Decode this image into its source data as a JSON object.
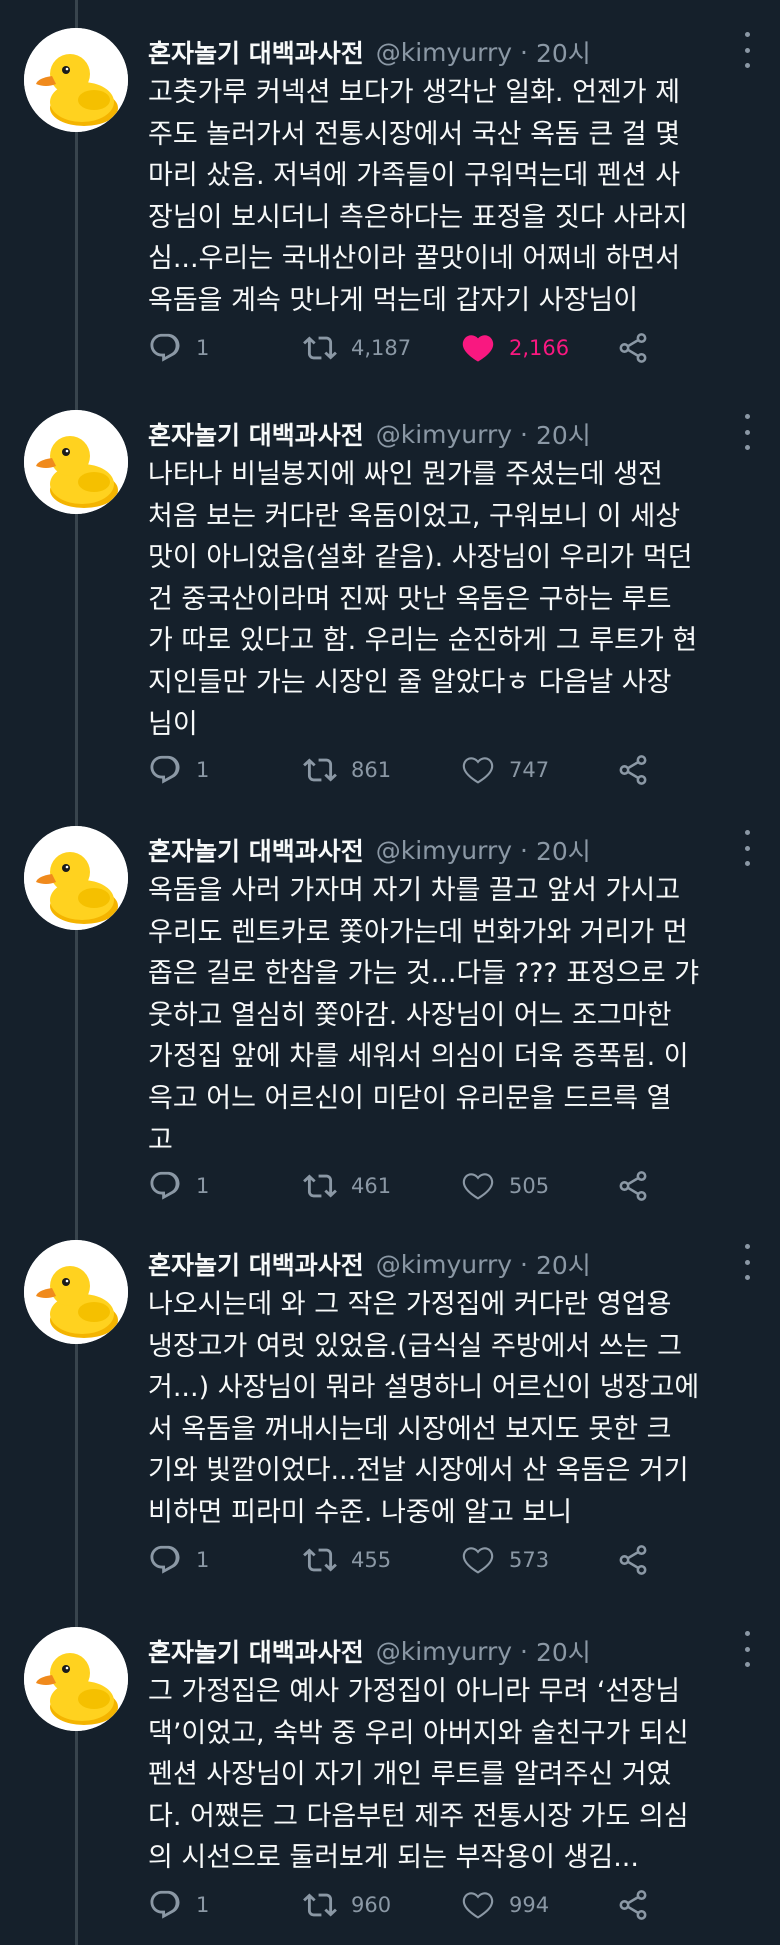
{
  "tweets": [
    {
      "name": "혼자놀기 대백과사전",
      "handle": "@kimyurry",
      "sep": "·",
      "time": "20시",
      "lines": [
        "고춧가루 커넥션 보다가 생각난 일화. 언젠가 제",
        "주도 놀러가서 전통시장에서 국산 옥돔 큰 걸 몇",
        "마리 샀음. 저녁에 가족들이 구워먹는데 펜션 사",
        "장님이 보시더니 측은하다는 표정을 짓다 사라지",
        "심...우리는 국내산이라 꿀맛이네 어쩌네 하면서",
        "옥돔을 계속 맛나게 먹는데 갑자기 사장님이"
      ],
      "replies": "1",
      "retweets": "4,187",
      "likes": "2,166",
      "liked": true
    },
    {
      "name": "혼자놀기 대백과사전",
      "handle": "@kimyurry",
      "sep": "·",
      "time": "20시",
      "lines": [
        "나타나 비닐봉지에 싸인 뭔가를 주셨는데 생전",
        "처음 보는 커다란 옥돔이었고, 구워보니 이 세상",
        "맛이 아니었음(설화 같음). 사장님이 우리가 먹던",
        "건 중국산이라며 진짜 맛난 옥돔은 구하는 루트",
        "가 따로 있다고 함. 우리는 순진하게 그 루트가 현",
        "지인들만 가는 시장인 줄 알았다ㅎ 다음날 사장",
        "님이"
      ],
      "replies": "1",
      "retweets": "861",
      "likes": "747",
      "liked": false
    },
    {
      "name": "혼자놀기 대백과사전",
      "handle": "@kimyurry",
      "sep": "·",
      "time": "20시",
      "lines": [
        "옥돔을 사러 가자며 자기 차를 끌고 앞서 가시고",
        "우리도 렌트카로 쫓아가는데 번화가와 거리가 먼",
        "좁은 길로 한참을 가는 것...다들 ??? 표정으로 갸",
        "웃하고 열심히 쫓아감. 사장님이 어느 조그마한",
        "가정집 앞에 차를 세워서 의심이 더욱 증폭됨. 이",
        "윽고 어느 어르신이 미닫이 유리문을 드르륵 열",
        "고"
      ],
      "replies": "1",
      "retweets": "461",
      "likes": "505",
      "liked": false
    },
    {
      "name": "혼자놀기 대백과사전",
      "handle": "@kimyurry",
      "sep": "·",
      "time": "20시",
      "lines": [
        "나오시는데 와 그 작은 가정집에 커다란 영업용",
        "냉장고가 여럿 있었음.(급식실 주방에서 쓰는 그",
        "거...) 사장님이 뭐라 설명하니 어르신이 냉장고에",
        "서 옥돔을 꺼내시는데 시장에선 보지도 못한 크",
        "기와 빛깔이었다...전날 시장에서 산 옥돔은 거기",
        "비하면 피라미 수준. 나중에 알고 보니"
      ],
      "replies": "1",
      "retweets": "455",
      "likes": "573",
      "liked": false
    },
    {
      "name": "혼자놀기 대백과사전",
      "handle": "@kimyurry",
      "sep": "·",
      "time": "20시",
      "lines": [
        "그 가정집은 예사 가정집이 아니라 무려 ‘선장님",
        "댁’이었고, 숙박 중 우리 아버지와 술친구가 되신",
        "펜션 사장님이 자기 개인 루트를 알려주신 거였",
        "다. 어쨌든 그 다음부턴 제주 전통시장 가도 의심",
        "의 시선으로 둘러보게 되는 부작용이 생김..."
      ],
      "replies": "1",
      "retweets": "960",
      "likes": "994",
      "liked": false
    }
  ],
  "icons": {
    "reply": "reply-icon",
    "retweet": "retweet-icon",
    "like": "heart-icon",
    "share": "share-icon",
    "more": "more-icon",
    "avatar": "rubber-duck-avatar"
  },
  "colors": {
    "background": "#15202b",
    "text": "#f7f9f9",
    "secondary": "#8b98a5",
    "like_active": "#f91880",
    "thread_line": "#38444d"
  }
}
